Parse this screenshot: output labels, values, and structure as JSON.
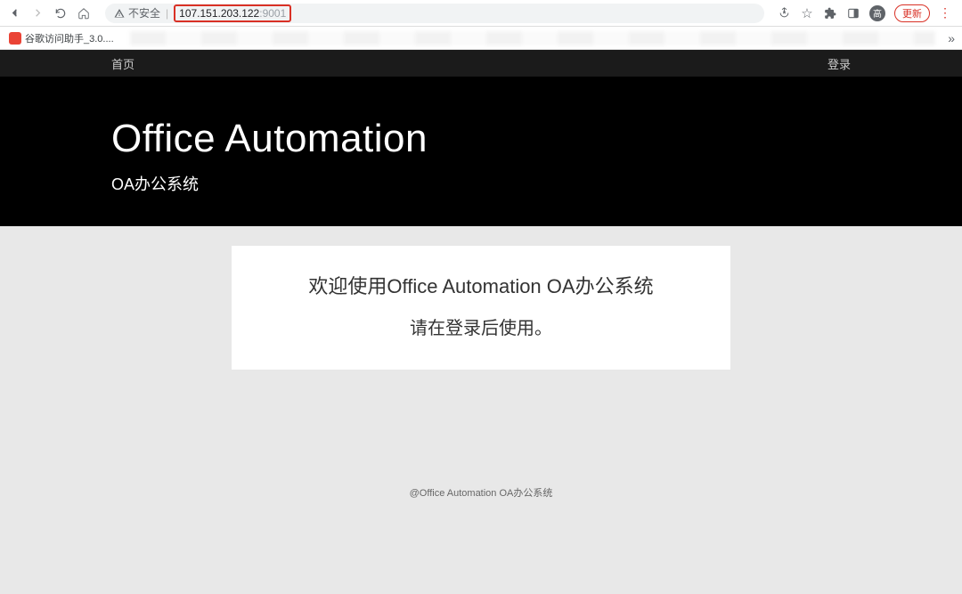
{
  "browser": {
    "insecure_label": "不安全",
    "url_host": "107.151.203.122",
    "url_port": ":9001",
    "update_label": "更新",
    "avatar_initial": "高"
  },
  "bookmarks": {
    "item1_label": "谷歌访问助手_3.0...."
  },
  "nav": {
    "home": "首页",
    "login": "登录"
  },
  "hero": {
    "title": "Office Automation",
    "subtitle": "OA办公系统"
  },
  "card": {
    "welcome": "欢迎使用Office Automation OA办公系统",
    "prompt": "请在登录后使用。"
  },
  "footer": {
    "text": "@Office Automation OA办公系统"
  }
}
